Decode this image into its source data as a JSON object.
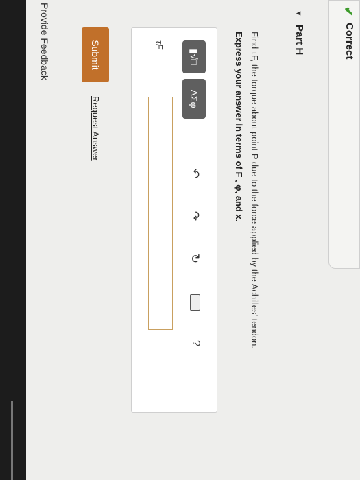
{
  "status": {
    "label": "Correct",
    "check_icon": "✔"
  },
  "part": {
    "caret": "▼",
    "title": "Part H"
  },
  "question": {
    "text": "Find τF, the torque about point P due to the force applied by the Achilles' tendon."
  },
  "instruction": {
    "text": "Express your answer in terms of F , φ, and x."
  },
  "toolbar": {
    "templates_label": "▮√□",
    "symbols_label": "ΑΣφ",
    "undo_icon": "↶",
    "redo_icon": "↷",
    "reset_icon": "↻",
    "help_icon": "?"
  },
  "answer": {
    "label": "τF =",
    "value": ""
  },
  "actions": {
    "submit_label": "Submit",
    "request_label": "Request Answer"
  },
  "footer": {
    "feedback_label": "Provide Feedback"
  },
  "colors": {
    "accent": "#c1702a",
    "check": "#3c9a2a"
  }
}
